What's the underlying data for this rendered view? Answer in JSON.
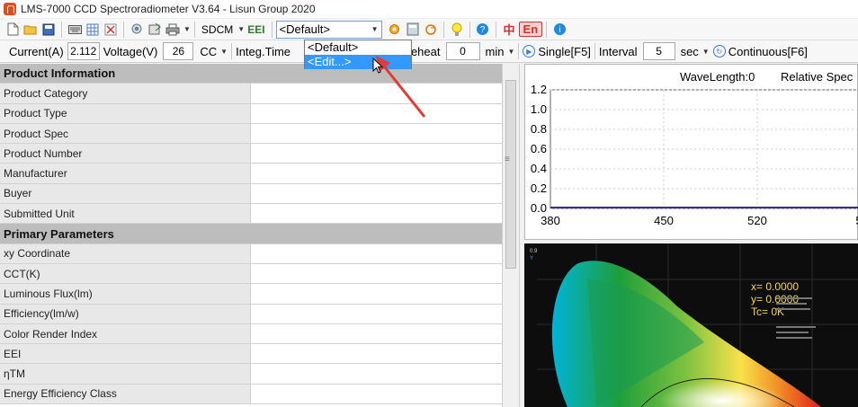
{
  "window": {
    "title": "LMS-7000 CCD Spectroradiometer V3.64 - Lisun Group 2020"
  },
  "toolbar1": {
    "sdcm_label": "SDCM",
    "eei_label": "EEI",
    "profile_value": "<Default>",
    "lang_cn": "中",
    "lang_en": "En"
  },
  "toolbar2": {
    "current_label": "Current(A)",
    "current_value": "2.112",
    "voltage_label": "Voltage(V)",
    "voltage_value": "26",
    "cc_label": "CC",
    "integ_label": "Integ.Time",
    "preheat_label": "Preheat",
    "preheat_value": "0",
    "min_label": "min",
    "single_label": "Single[F5]",
    "interval_label": "Interval",
    "interval_value": "5",
    "sec_label": "sec",
    "continuous_label": "Continuous[F6]"
  },
  "dropdown": {
    "options": [
      "<Default>",
      "<Edit...>"
    ],
    "selected_index": 1
  },
  "table": {
    "sections": [
      {
        "header": "Product Information",
        "rows": [
          "Product Category",
          "Product Type",
          "Product Spec",
          "Product Number",
          "Manufacturer",
          "Buyer",
          "Submitted Unit"
        ]
      },
      {
        "header": "Primary Parameters",
        "rows": [
          "xy Coordinate",
          "CCT(K)",
          "Luminous Flux(lm)",
          "Efficiency(lm/w)",
          "Color Render Index",
          "EEI",
          "ηTM",
          "Energy Efficiency Class"
        ]
      }
    ]
  },
  "spectrum": {
    "header_wavelength": "WaveLength:0",
    "header_relative": "Relative Spec",
    "y_ticks": [
      "1.2",
      "1.0",
      "0.8",
      "0.6",
      "0.4",
      "0.2",
      "0.0"
    ],
    "x_ticks": [
      "380",
      "450",
      "520",
      "5"
    ]
  },
  "cie": {
    "x_readout": "x= 0.0000",
    "y_readout": "y= 0.0000",
    "tc_readout": "Tc= 0K"
  },
  "colors": {
    "accent": "#3399ff",
    "section_header_bg": "#bdbdbd",
    "label_cell_bg": "#e8e8e8",
    "readout": "#f5d547",
    "arrow": "#e53935"
  }
}
